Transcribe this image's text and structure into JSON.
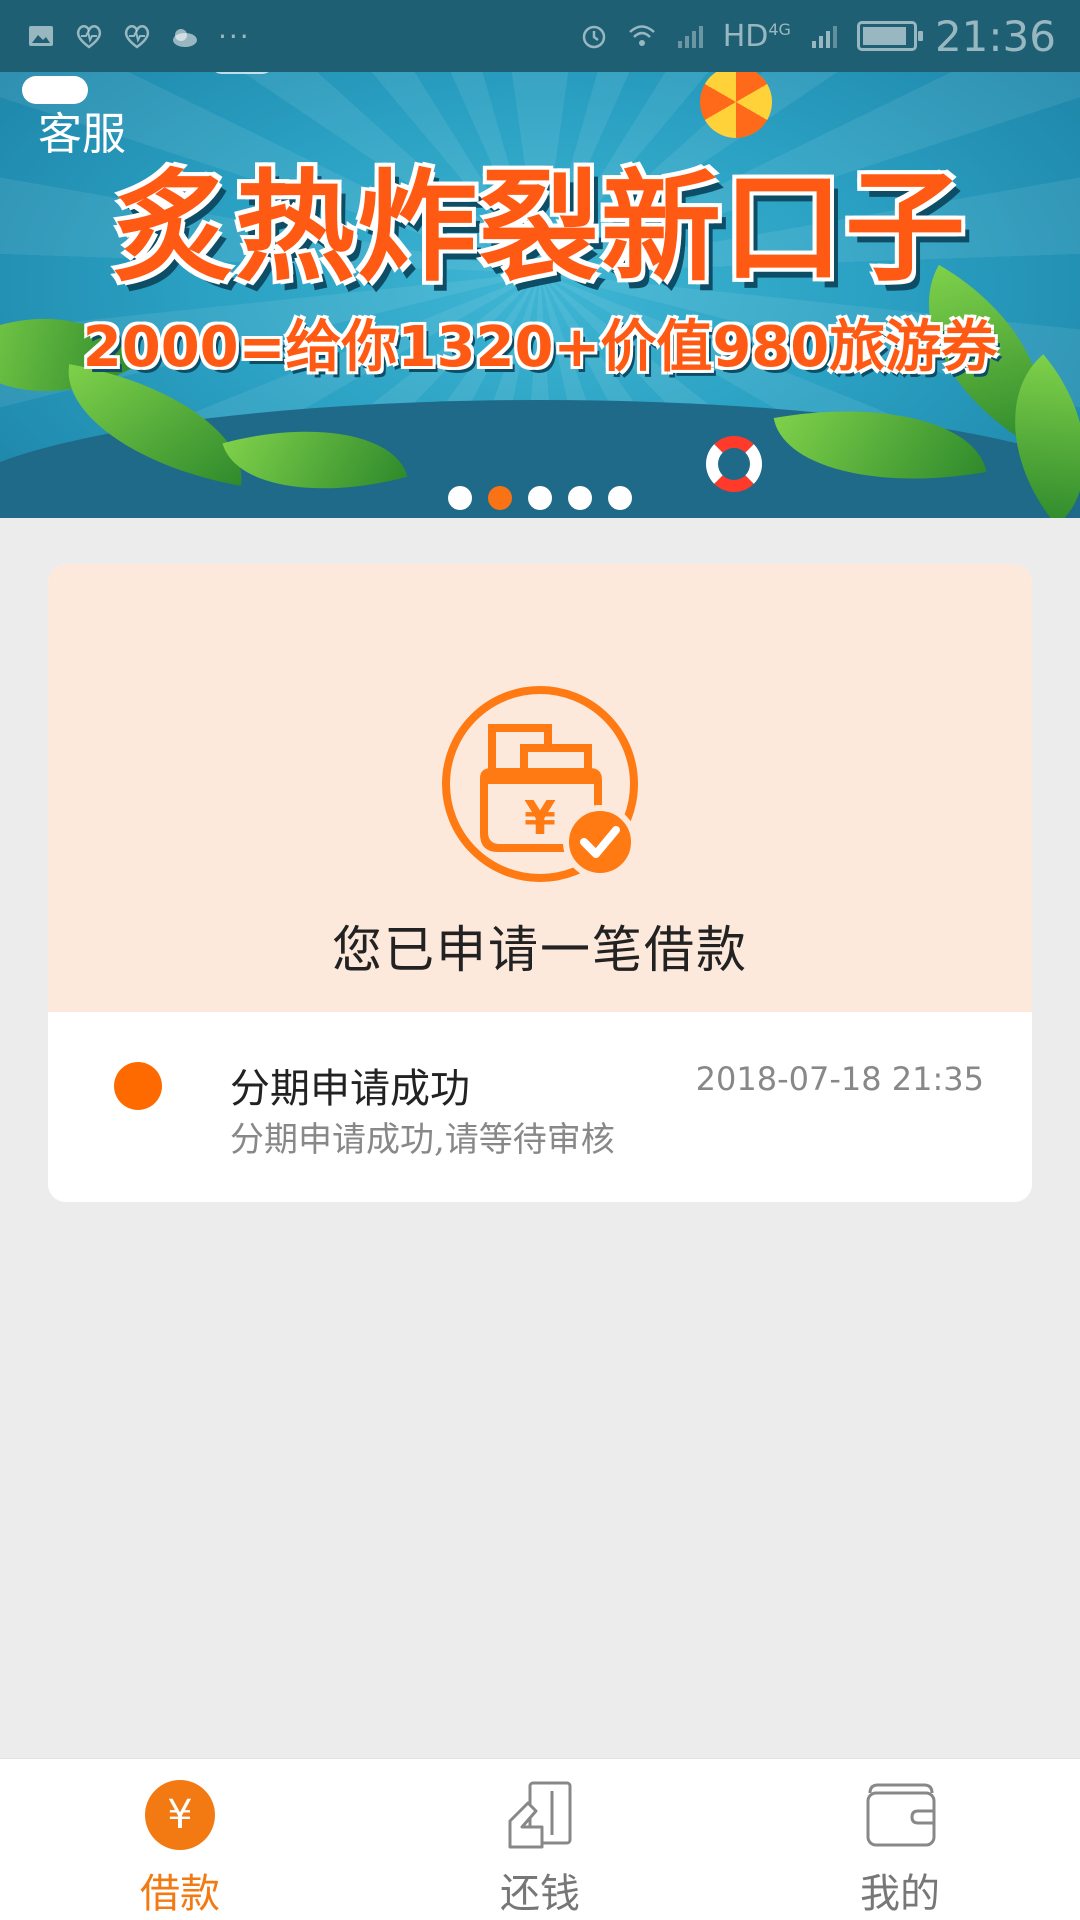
{
  "status_bar": {
    "network": "HD",
    "network_gen": "4G",
    "time": "21:36",
    "icons": [
      "image-icon",
      "heart-rate-icon",
      "heart-rate-icon",
      "weather-icon",
      "more-icon",
      "alarm-icon",
      "wifi-icon",
      "signal-icon",
      "battery-icon"
    ]
  },
  "banner": {
    "customer_service": "客服",
    "headline": "炙热炸裂新口子",
    "subline": "2000=给你1320+价值980旅游券",
    "slide_count": 5,
    "active_slide": 2
  },
  "loan_card": {
    "icon": "wallet-check-icon",
    "heading": "您已申请一笔借款",
    "entry": {
      "title": "分期申请成功",
      "description": "分期申请成功,请等待审核",
      "time": "2018-07-18 21:35"
    }
  },
  "bottom_nav": {
    "items": [
      {
        "label": "借款",
        "icon": "yuan-icon",
        "active": true
      },
      {
        "label": "还钱",
        "icon": "repay-icon",
        "active": false
      },
      {
        "label": "我的",
        "icon": "wallet-icon",
        "active": false
      }
    ]
  },
  "colors": {
    "accent": "#f37a12",
    "status_dot": "#ff6a00",
    "card_header_bg": "#fde9dc",
    "page_bg": "#ececec"
  }
}
